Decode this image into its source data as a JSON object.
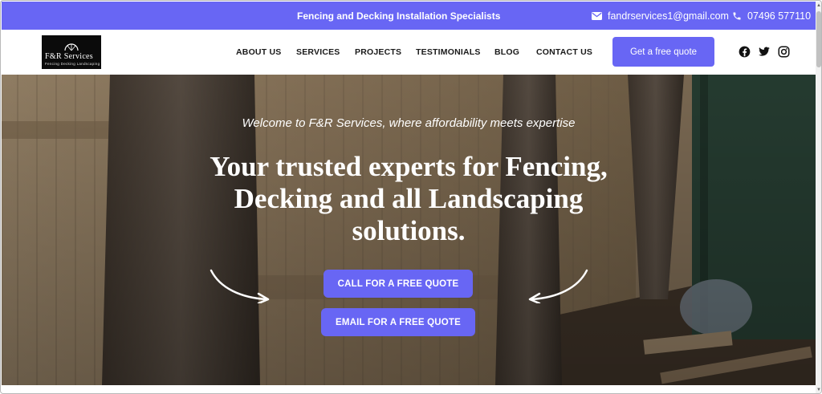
{
  "topbar": {
    "tagline": "Fencing and Decking  Installation Specialists",
    "email": "fandrservices1@gmail.com",
    "phone": "07496 577110",
    "email_icon": "envelope-icon",
    "phone_icon": "phone-icon"
  },
  "logo": {
    "name": "F&R Services",
    "subtitle": "Fencing  Decking  Landscaping"
  },
  "nav": {
    "about": "ABOUT US",
    "services": "SERVICES",
    "projects": "PROJECTS",
    "testimonials": "TESTIMONIALS",
    "blog": "BLOG",
    "contact": "CONTACT US",
    "quote_button": "Get a free quote"
  },
  "social": [
    "facebook-icon",
    "twitter-icon",
    "instagram-icon"
  ],
  "hero": {
    "welcome": "Welcome to F&R Services, where affordability meets expertise",
    "headline": "Your trusted experts for Fencing, Decking and all Landscaping solutions.",
    "cta_call": "CALL FOR A FREE QUOTE",
    "cta_email": "EMAIL FOR A FREE QUOTE"
  },
  "colors": {
    "accent": "#6866f4",
    "text_dark": "#1a1a1a",
    "white": "#ffffff"
  }
}
